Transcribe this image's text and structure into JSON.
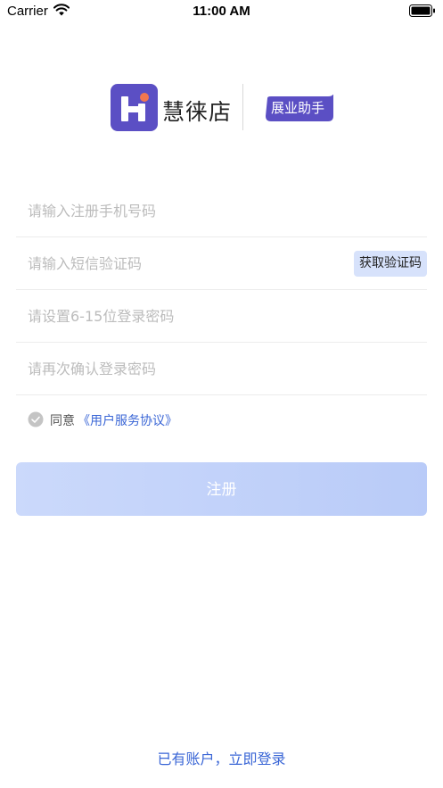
{
  "status_bar": {
    "carrier": "Carrier",
    "time": "11:00 AM"
  },
  "brand": {
    "name": "慧徕店",
    "tag": "展业助手",
    "logo_color": "#5b4fc4",
    "logo_dot_color": "#f2774f"
  },
  "form": {
    "phone_placeholder": "请输入注册手机号码",
    "code_placeholder": "请输入短信验证码",
    "get_code_label": "获取验证码",
    "password_placeholder": "请设置6-15位登录密码",
    "confirm_placeholder": "请再次确认登录密码"
  },
  "agreement": {
    "prefix": "同意",
    "link": "《用户服务协议》"
  },
  "register_label": "注册",
  "login_link": "已有账户，立即登录",
  "colors": {
    "accent": "#3a66d6",
    "button_start": "#cbd9fb",
    "button_end": "#b9cbf8"
  }
}
